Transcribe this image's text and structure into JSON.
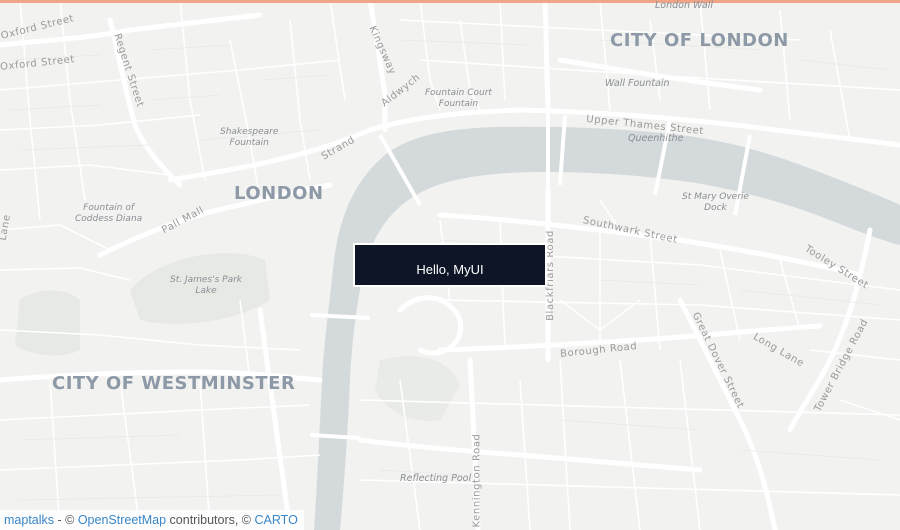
{
  "colors": {
    "land": "#f2f2f0",
    "water": "#d4dadc",
    "road": "#ffffff",
    "park": "#e5e8e3",
    "accent_bar": "#f0a488",
    "popup_bg": "#0e1526",
    "link": "#3a86c8"
  },
  "popup": {
    "text": "Hello, MyUI"
  },
  "attribution": {
    "library": "maptalks",
    "sep1": " - © ",
    "osm": "OpenStreetMap",
    "mid": " contributors, © ",
    "carto": "CARTO"
  },
  "cities": {
    "city_of_london": "CITY OF LONDON",
    "london": "LONDON",
    "westminster": "CITY OF WESTMINSTER"
  },
  "pois": {
    "fountain_court": [
      "Fountain Court",
      "Fountain"
    ],
    "wall_fountain": "Wall Fountain",
    "shakespeare": [
      "Shakespeare",
      "Fountain"
    ],
    "queenhithe": "Queenhithe",
    "st_mary_overie": [
      "St Mary Overie",
      "Dock"
    ],
    "coddess_diana": [
      "Fountain of",
      "Coddess Diana"
    ],
    "st_james_park_lake": [
      "St. James's Park",
      "Lake"
    ],
    "reflecting_pool": "Reflecting Pool",
    "london_wall": "London Wall"
  },
  "streets": {
    "oxford_street_1": "Oxford Street",
    "oxford_street_2": "Oxford Street",
    "regent_street": "Regent Street",
    "kingsway": "Kingsway",
    "aldwych": "Aldwych",
    "strand": "Strand",
    "pall_mall": "Pall Mall",
    "upper_thames": "Upper Thames Street",
    "southwark": "Southwark Street",
    "tooley": "Tooley Street",
    "blackfriars": "Blackfriars Road",
    "borough": "Borough Road",
    "great_dover": "Great Dover Street",
    "long_lane": "Long Lane",
    "tower_bridge": "Tower Bridge Road",
    "kennington": "Kennington Road",
    "lane": "Lane"
  }
}
